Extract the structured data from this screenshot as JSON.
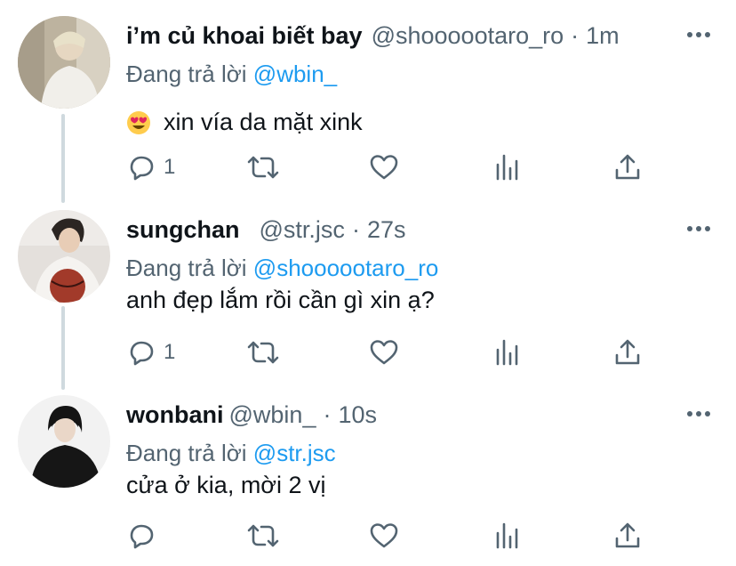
{
  "tweets": [
    {
      "display_name": "i’m củ khoai biết bay",
      "handle": "@shoooootaro_ro",
      "separator": "·",
      "time": "1m",
      "replying_prefix": "Đang trả lời",
      "replying_to": "@wbin_",
      "emoji": "smiling-face-heart-eyes",
      "text": "xin vía da mặt xink",
      "reply_count": "1"
    },
    {
      "display_name": "sungchan",
      "handle": "@str.jsc",
      "separator": "·",
      "time": "27s",
      "replying_prefix": "Đang trả lời",
      "replying_to": "@shoooootaro_ro",
      "text": "anh đẹp lắm rồi cần gì xin ạ?",
      "reply_count": "1"
    },
    {
      "display_name": "wonbani",
      "handle": "@wbin_",
      "separator": "·",
      "time": "10s",
      "replying_prefix": "Đang trả lời",
      "replying_to": "@str.jsc",
      "text": "cửa ở kia, mời 2 vị",
      "reply_count": ""
    }
  ],
  "colors": {
    "text": "#0f1419",
    "secondary": "#536471",
    "link": "#1d9bf0",
    "thread_line": "#cfd9de"
  },
  "icons": {
    "more": "more-horizontal-icon",
    "reply": "reply-icon",
    "retweet": "retweet-icon",
    "like": "heart-icon",
    "analytics": "analytics-icon",
    "share": "share-icon"
  }
}
